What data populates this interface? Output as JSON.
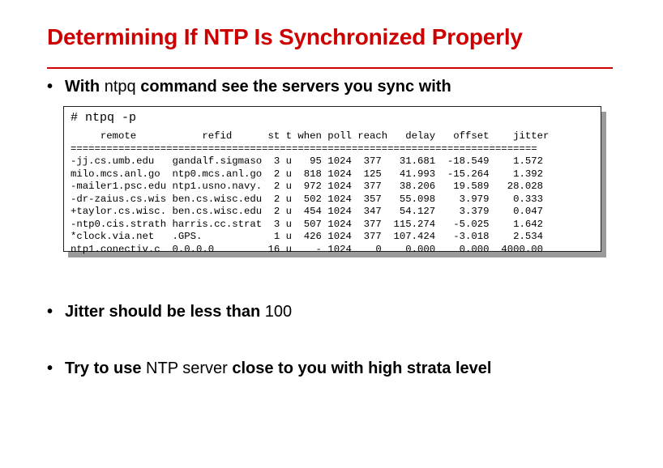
{
  "slide": {
    "title": "Determining If NTP Is Synchronized Properly",
    "bullets": {
      "b1": {
        "symbol": "•",
        "parts": [
          "With ",
          "ntpq",
          " command see the servers you sync with"
        ]
      },
      "b2": {
        "symbol": "•",
        "parts": [
          "Jitter should be less than ",
          "100"
        ]
      },
      "b3": {
        "symbol": "•",
        "parts": [
          "Try to use ",
          "NTP server",
          " close to you with high strata level"
        ]
      }
    }
  },
  "terminal": {
    "command": "# ntpq -p",
    "header": "     remote           refid      st t when poll reach   delay   offset    jitter",
    "separator": "==============================================================================",
    "rows": [
      "-jj.cs.umb.edu   gandalf.sigmaso  3 u   95 1024  377   31.681  -18.549    1.572",
      "milo.mcs.anl.go  ntp0.mcs.anl.go  2 u  818 1024  125   41.993  -15.264    1.392",
      "-mailer1.psc.edu ntp1.usno.navy.  2 u  972 1024  377   38.206   19.589   28.028",
      "-dr-zaius.cs.wis ben.cs.wisc.edu  2 u  502 1024  357   55.098    3.979    0.333",
      "+taylor.cs.wisc. ben.cs.wisc.edu  2 u  454 1024  347   54.127    3.379    0.047",
      "-ntp0.cis.strath harris.cc.strat  3 u  507 1024  377  115.274   -5.025    1.642",
      "*clock.via.net   .GPS.            1 u  426 1024  377  107.424   -3.018    2.534",
      "ntp1.conectiv.c  0.0.0.0         16 u    - 1024    0    0.000    0.000  4000.00"
    ]
  }
}
